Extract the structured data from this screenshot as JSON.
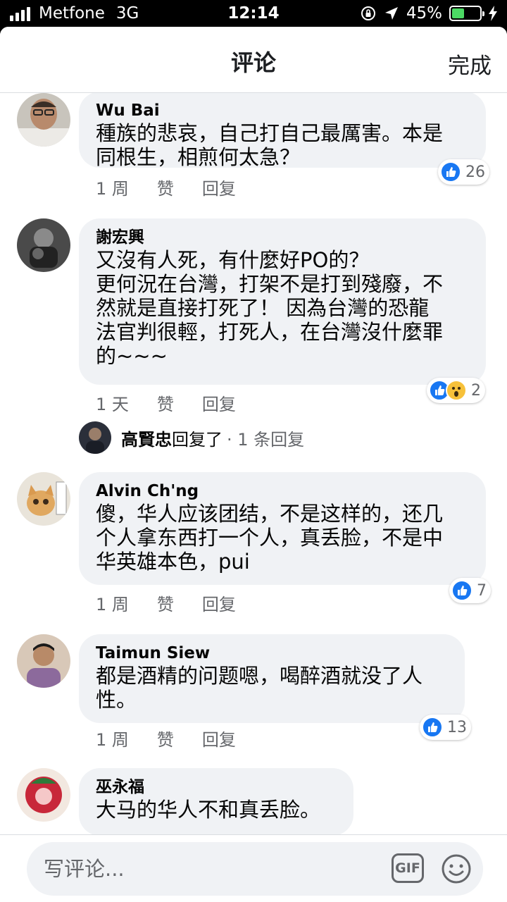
{
  "status_bar": {
    "carrier": "Metfone",
    "network": "3G",
    "time": "12:14",
    "battery": "45%",
    "battery_level": 0.45,
    "icons": [
      "signal-icon",
      "orientation-lock-icon",
      "location-arrow-icon",
      "battery-icon",
      "charging-bolt-icon"
    ]
  },
  "header": {
    "title": "评论",
    "done_label": "完成"
  },
  "comments": [
    {
      "author": "Wu Bai",
      "text": "種族的悲哀，自己打自己最厲害。本是同根生，相煎何太急？",
      "time": "1 周",
      "like_label": "赞",
      "reply_label": "回复",
      "reaction_count": "26",
      "reactions": [
        "like"
      ]
    },
    {
      "author": "謝宏興",
      "text": "又沒有人死，有什麼好PO的？\n更何況在台灣，打架不是打到殘廢，不然就是直接打死了！ 因為台灣的恐龍法官判很輕，打死人，在台灣沒什麼罪的~~~",
      "time": "1 天",
      "like_label": "赞",
      "reply_label": "回复",
      "reaction_count": "2",
      "reactions": [
        "like",
        "wow"
      ],
      "reply_summary": {
        "name": "高賢忠",
        "verb": "回复了",
        "count": "· 1 条回复"
      }
    },
    {
      "author": "Alvin Ch'ng",
      "text": "傻，华人应该团结，不是这样的，还几个人拿东西打一个人，真丢脸，不是中华英雄本色，pui",
      "time": "1 周",
      "like_label": "赞",
      "reply_label": "回复",
      "reaction_count": "7",
      "reactions": [
        "like"
      ]
    },
    {
      "author": "Taimun Siew",
      "text": "都是酒精的问题嗯，喝醉酒就没了人性。",
      "time": "1 周",
      "like_label": "赞",
      "reply_label": "回复",
      "reaction_count": "13",
      "reactions": [
        "like"
      ]
    },
    {
      "author": "巫永福",
      "text": "大马的华人不和真丢脸。"
    }
  ],
  "composer": {
    "placeholder": "写评论...",
    "gif_label": "GIF"
  },
  "colors": {
    "accent": "#1877f2",
    "bubble": "#f0f2f5",
    "meta_text": "#65676b",
    "wow": "#f7c13a"
  }
}
